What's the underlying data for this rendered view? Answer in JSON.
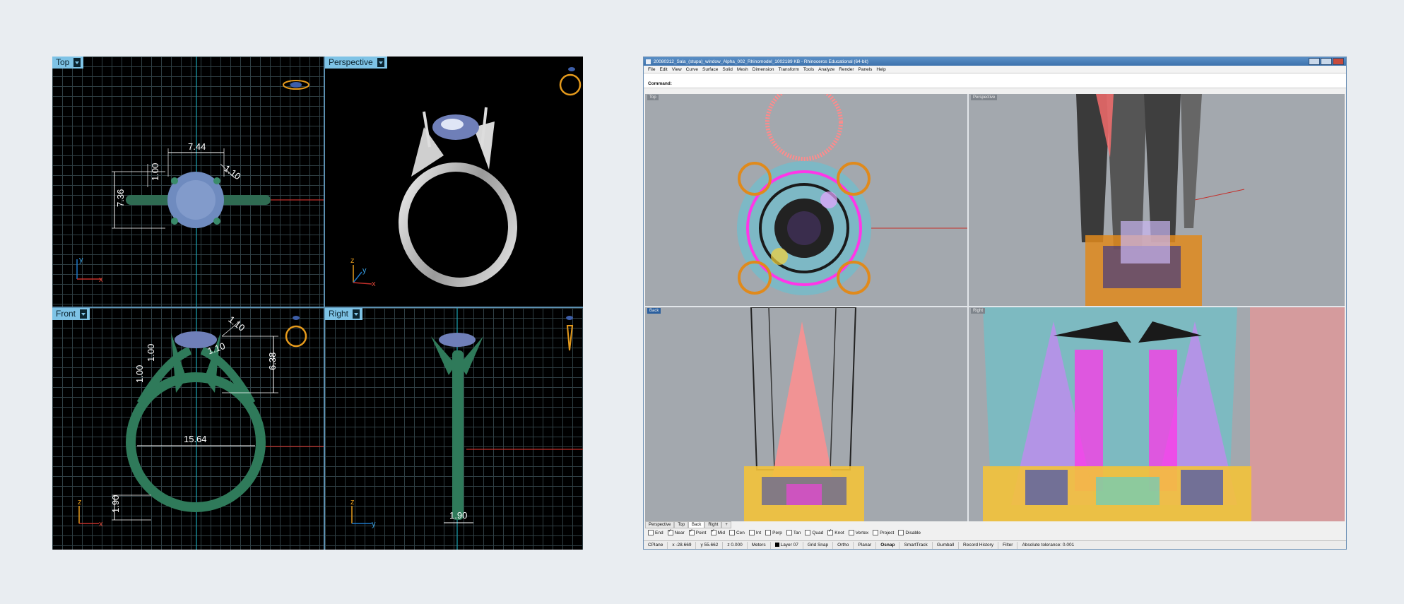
{
  "left": {
    "viewports": {
      "top": "Top",
      "perspective": "Perspective",
      "front": "Front",
      "right": "Right"
    },
    "dimensions": {
      "top_width": "7.44",
      "top_height": "7.36",
      "top_prong": "1.00",
      "top_diag": "1.10",
      "front_diag": "1.10",
      "front_prong_h": "1.00",
      "front_prong_w": "1.00",
      "front_side": "1.10",
      "front_height": "6.38",
      "front_diameter": "15.64",
      "front_band": "1.90",
      "right_band": "1.90"
    },
    "axes": {
      "x": "x",
      "y": "y",
      "z": "z"
    }
  },
  "rhino": {
    "title": "20080312_Sala_(stupa)_window_Alpha_002_Rhinomodel_1002189 KB - Rhinoceros Educational (64-bit)",
    "menu": [
      "File",
      "Edit",
      "View",
      "Curve",
      "Surface",
      "Solid",
      "Mesh",
      "Dimension",
      "Transform",
      "Tools",
      "Analyze",
      "Render",
      "Panels",
      "Help"
    ],
    "command_label": "Command:",
    "viewports": {
      "top": "Top",
      "perspective": "Perspective",
      "back": "Back",
      "right": "Right"
    },
    "tabs": [
      "Perspective",
      "Top",
      "Back",
      "Right",
      "+"
    ],
    "active_tab": "Back",
    "osnaps": [
      {
        "label": "End",
        "on": false
      },
      {
        "label": "Near",
        "on": true
      },
      {
        "label": "Point",
        "on": true
      },
      {
        "label": "Mid",
        "on": true
      },
      {
        "label": "Cen",
        "on": false
      },
      {
        "label": "Int",
        "on": false
      },
      {
        "label": "Perp",
        "on": false
      },
      {
        "label": "Tan",
        "on": false
      },
      {
        "label": "Quad",
        "on": false
      },
      {
        "label": "Knot",
        "on": true
      },
      {
        "label": "Vertex",
        "on": false
      },
      {
        "label": "Project",
        "on": false
      },
      {
        "label": "Disable",
        "on": false
      }
    ],
    "status": {
      "cplane": "CPlane",
      "x": "x -28.669",
      "y": "y 55.662",
      "z": "z 0.000",
      "units": "Meters",
      "layer": "Layer 07",
      "grid_snap": "Grid Snap",
      "ortho": "Ortho",
      "planar": "Planar",
      "osnap": "Osnap",
      "smarttrack": "SmartTrack",
      "gumball": "Gumball",
      "record_history": "Record History",
      "filter": "Filter",
      "tolerance": "Absolute tolerance: 0.001"
    }
  }
}
